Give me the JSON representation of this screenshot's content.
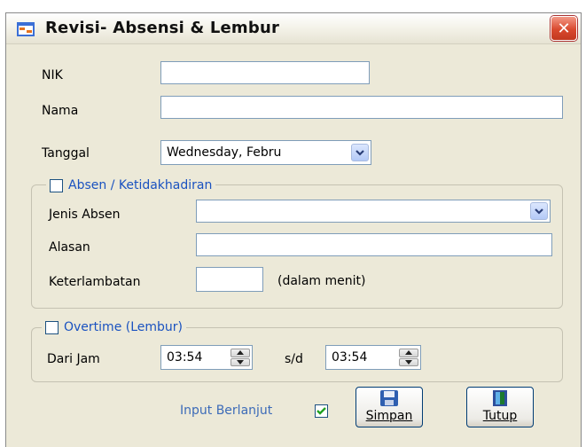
{
  "window": {
    "title": "Revisi- Absensi & Lembur",
    "close_label": "✕"
  },
  "fields": {
    "nik": {
      "label": "NIK",
      "value": ""
    },
    "nama": {
      "label": "Nama",
      "value": ""
    },
    "tanggal": {
      "label": "Tanggal",
      "value": "Wednesday,  Febru"
    }
  },
  "absen_group": {
    "title": "Absen / Ketidakhadiran",
    "checked": false,
    "jenis_label": "Jenis Absen",
    "jenis_value": "",
    "alasan_label": "Alasan",
    "alasan_value": "",
    "terlambat_label": "Keterlambatan",
    "terlambat_value": "",
    "terlambat_unit": "(dalam menit)"
  },
  "overtime_group": {
    "title": "Overtime (Lembur)",
    "checked": false,
    "dari_label": "Dari Jam",
    "dari_value": "03:54",
    "sd_label": "s/d",
    "sampai_value": "03:54"
  },
  "footer": {
    "input_berlanjut_label": "Input Berlanjut",
    "input_berlanjut_checked": true,
    "simpan_label": "Simpan",
    "tutup_label": "Tutup"
  },
  "colors": {
    "accent_text": "#1a52c0",
    "check_green": "#21a121"
  }
}
